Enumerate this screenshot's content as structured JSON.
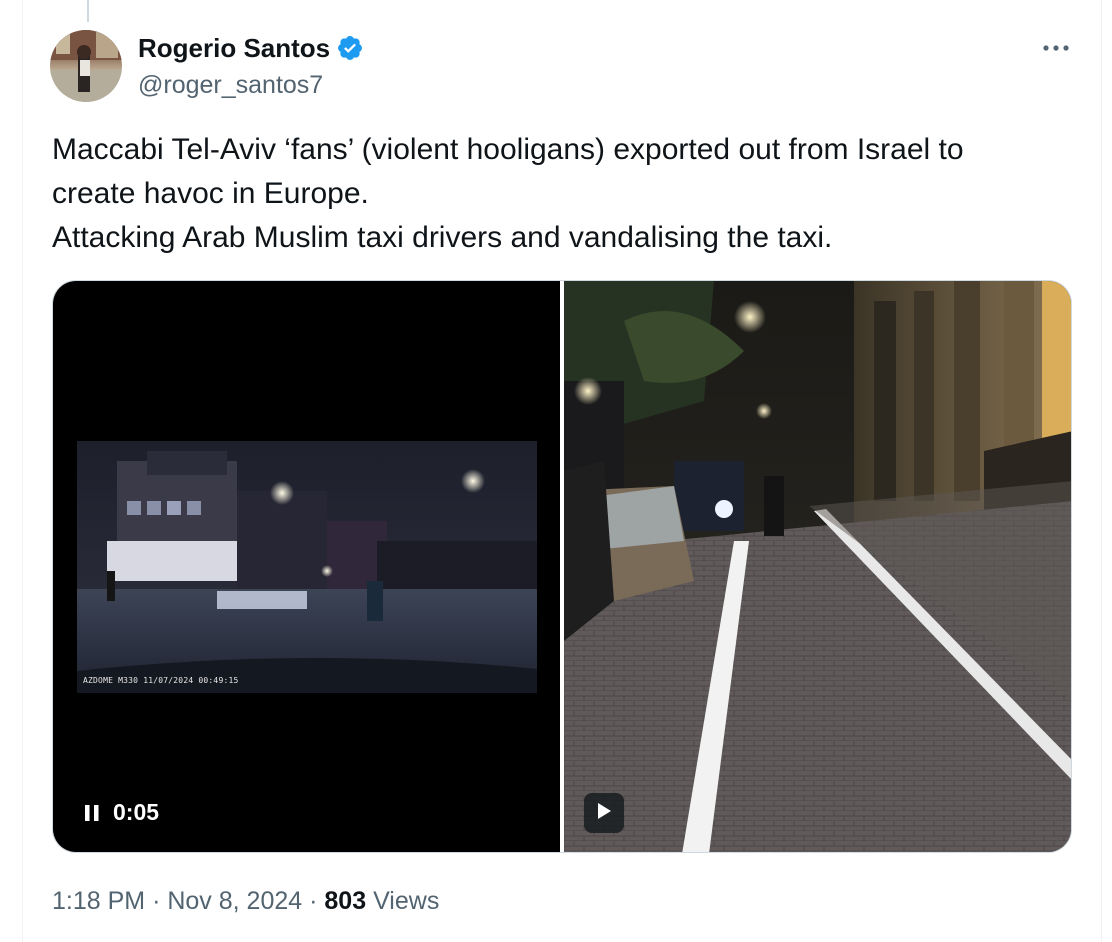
{
  "author": {
    "display_name": "Rogerio Santos",
    "handle": "@roger_santos7",
    "verified": true,
    "verified_color": "#1d9bf0"
  },
  "tweet": {
    "lines": [
      "Maccabi Tel-Aviv ‘fans’ (violent hooligans) exported out from Israel to",
      "create havoc in Europe.",
      "Attacking Arab Muslim taxi drivers and vandalising the taxi."
    ]
  },
  "media": {
    "left_video": {
      "dashcam_caption": "AZDOME M330 11/07/2024 00:49:15",
      "elapsed": "0:05",
      "state": "playing"
    },
    "right_video": {
      "state": "paused"
    }
  },
  "meta": {
    "time": "1:18 PM",
    "separator": "·",
    "date": "Nov 8, 2024",
    "views_count": "803",
    "views_label": "Views"
  },
  "icons": {
    "more": "more-horizontal-icon",
    "verified": "verified-badge-icon",
    "pause": "pause-icon",
    "play": "play-icon"
  }
}
